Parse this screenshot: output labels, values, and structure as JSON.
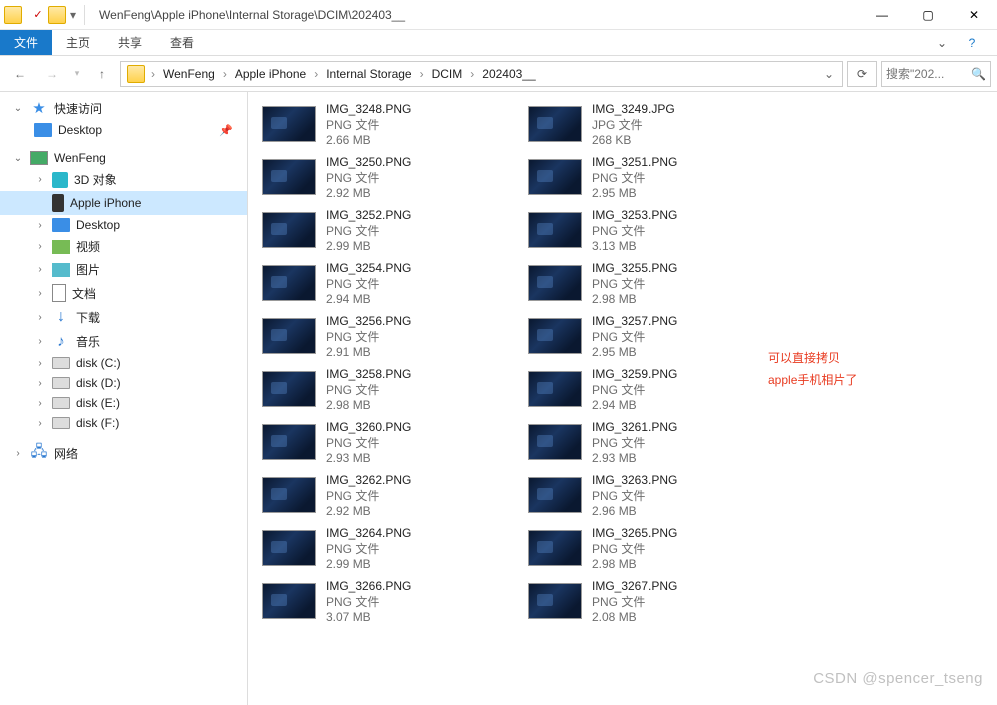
{
  "titlebar": {
    "path_text": "WenFeng\\Apple iPhone\\Internal Storage\\DCIM\\202403__"
  },
  "ribbon": {
    "file": "文件",
    "home": "主页",
    "share": "共享",
    "view": "查看"
  },
  "breadcrumbs": [
    "WenFeng",
    "Apple iPhone",
    "Internal Storage",
    "DCIM",
    "202403__"
  ],
  "search": {
    "placeholder": "搜索\"202..."
  },
  "sidebar": {
    "quick": "快速访问",
    "desktop": "Desktop",
    "pc": "WenFeng",
    "children": [
      {
        "label": "3D 对象",
        "icon": "ic-3d"
      },
      {
        "label": "Apple iPhone",
        "icon": "ic-phone",
        "selected": true
      },
      {
        "label": "Desktop",
        "icon": "ic-desktop"
      },
      {
        "label": "视频",
        "icon": "ic-video"
      },
      {
        "label": "图片",
        "icon": "ic-pic"
      },
      {
        "label": "文档",
        "icon": "ic-doc"
      },
      {
        "label": "下载",
        "icon": "ic-dl",
        "glyph": "↓"
      },
      {
        "label": "音乐",
        "icon": "ic-music",
        "glyph": "♪"
      },
      {
        "label": "disk (C:)",
        "icon": "ic-disk"
      },
      {
        "label": "disk (D:)",
        "icon": "ic-disk"
      },
      {
        "label": "disk (E:)",
        "icon": "ic-disk"
      },
      {
        "label": "disk (F:)",
        "icon": "ic-disk"
      }
    ],
    "network": "网络"
  },
  "files": [
    {
      "name": "IMG_3248.PNG",
      "type": "PNG 文件",
      "size": "2.66 MB"
    },
    {
      "name": "IMG_3249.JPG",
      "type": "JPG 文件",
      "size": "268 KB"
    },
    {
      "name": "IMG_3250.PNG",
      "type": "PNG 文件",
      "size": "2.92 MB"
    },
    {
      "name": "IMG_3251.PNG",
      "type": "PNG 文件",
      "size": "2.95 MB"
    },
    {
      "name": "IMG_3252.PNG",
      "type": "PNG 文件",
      "size": "2.99 MB"
    },
    {
      "name": "IMG_3253.PNG",
      "type": "PNG 文件",
      "size": "3.13 MB"
    },
    {
      "name": "IMG_3254.PNG",
      "type": "PNG 文件",
      "size": "2.94 MB"
    },
    {
      "name": "IMG_3255.PNG",
      "type": "PNG 文件",
      "size": "2.98 MB"
    },
    {
      "name": "IMG_3256.PNG",
      "type": "PNG 文件",
      "size": "2.91 MB"
    },
    {
      "name": "IMG_3257.PNG",
      "type": "PNG 文件",
      "size": "2.95 MB"
    },
    {
      "name": "IMG_3258.PNG",
      "type": "PNG 文件",
      "size": "2.98 MB"
    },
    {
      "name": "IMG_3259.PNG",
      "type": "PNG 文件",
      "size": "2.94 MB"
    },
    {
      "name": "IMG_3260.PNG",
      "type": "PNG 文件",
      "size": "2.93 MB"
    },
    {
      "name": "IMG_3261.PNG",
      "type": "PNG 文件",
      "size": "2.93 MB"
    },
    {
      "name": "IMG_3262.PNG",
      "type": "PNG 文件",
      "size": "2.92 MB"
    },
    {
      "name": "IMG_3263.PNG",
      "type": "PNG 文件",
      "size": "2.96 MB"
    },
    {
      "name": "IMG_3264.PNG",
      "type": "PNG 文件",
      "size": "2.99 MB"
    },
    {
      "name": "IMG_3265.PNG",
      "type": "PNG 文件",
      "size": "2.98 MB"
    },
    {
      "name": "IMG_3266.PNG",
      "type": "PNG 文件",
      "size": "3.07 MB"
    },
    {
      "name": "IMG_3267.PNG",
      "type": "PNG 文件",
      "size": "2.08 MB"
    }
  ],
  "annotation": {
    "line1": "可以直接拷贝",
    "line2": "apple手机相片了"
  },
  "watermark": "CSDN @spencer_tseng"
}
